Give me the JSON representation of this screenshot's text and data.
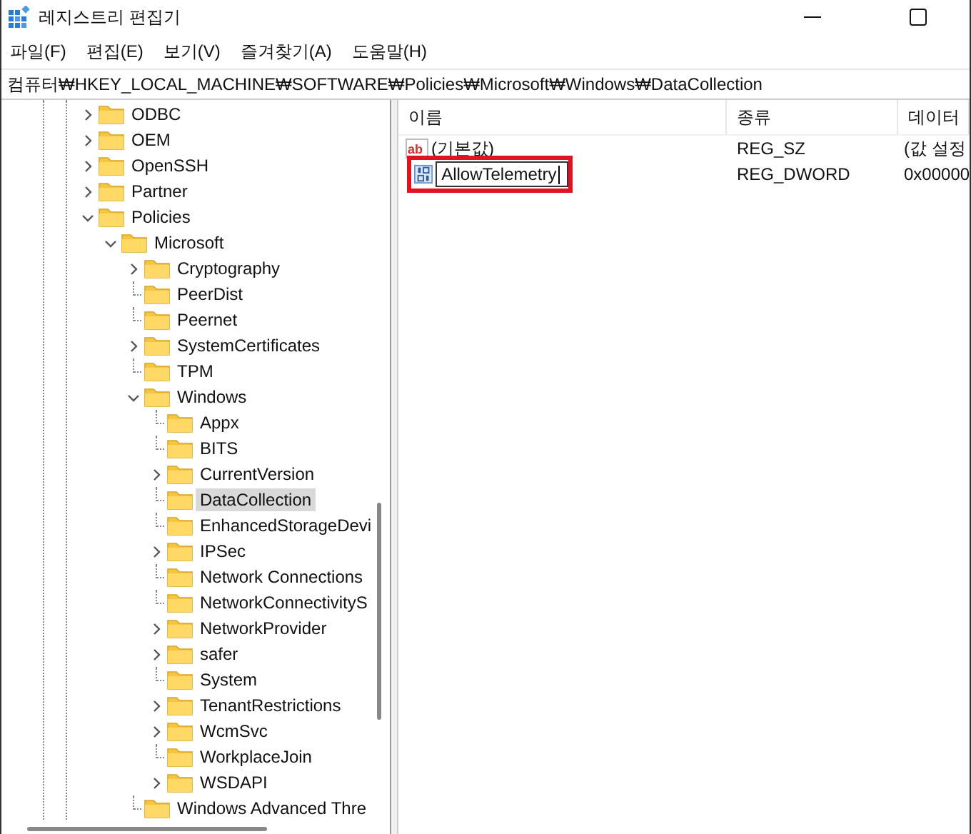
{
  "window": {
    "title": "레지스트리 편집기"
  },
  "menu": [
    "파일(F)",
    "편집(E)",
    "보기(V)",
    "즐겨찾기(A)",
    "도움말(H)"
  ],
  "address": "컴퓨터₩HKEY_LOCAL_MACHINE₩SOFTWARE₩Policies₩Microsoft₩Windows₩DataCollection",
  "tree": {
    "items": [
      {
        "label": "ODBC",
        "kind": "branch",
        "expanded": false,
        "selected": false
      },
      {
        "label": "OEM",
        "kind": "branch",
        "expanded": false,
        "selected": false
      },
      {
        "label": "OpenSSH",
        "kind": "branch",
        "expanded": false,
        "selected": false
      },
      {
        "label": "Partner",
        "kind": "branch",
        "expanded": false,
        "selected": false
      },
      {
        "label": "Policies",
        "kind": "branch",
        "expanded": true,
        "selected": false,
        "children": [
          {
            "label": "Microsoft",
            "kind": "branch",
            "expanded": true,
            "selected": false,
            "children": [
              {
                "label": "Cryptography",
                "kind": "branch",
                "expanded": false,
                "selected": false
              },
              {
                "label": "PeerDist",
                "kind": "leaf",
                "selected": false
              },
              {
                "label": "Peernet",
                "kind": "leaf",
                "selected": false
              },
              {
                "label": "SystemCertificates",
                "kind": "branch",
                "expanded": false,
                "selected": false
              },
              {
                "label": "TPM",
                "kind": "leaf",
                "selected": false
              },
              {
                "label": "Windows",
                "kind": "branch",
                "expanded": true,
                "selected": false,
                "children": [
                  {
                    "label": "Appx",
                    "kind": "leaf",
                    "selected": false
                  },
                  {
                    "label": "BITS",
                    "kind": "leaf",
                    "selected": false
                  },
                  {
                    "label": "CurrentVersion",
                    "kind": "branch",
                    "expanded": false,
                    "selected": false
                  },
                  {
                    "label": "DataCollection",
                    "kind": "leaf",
                    "selected": true
                  },
                  {
                    "label": "EnhancedStorageDevi",
                    "kind": "leaf",
                    "selected": false
                  },
                  {
                    "label": "IPSec",
                    "kind": "branch",
                    "expanded": false,
                    "selected": false
                  },
                  {
                    "label": "Network Connections",
                    "kind": "leaf",
                    "selected": false
                  },
                  {
                    "label": "NetworkConnectivityS",
                    "kind": "leaf",
                    "selected": false
                  },
                  {
                    "label": "NetworkProvider",
                    "kind": "branch",
                    "expanded": false,
                    "selected": false
                  },
                  {
                    "label": "safer",
                    "kind": "branch",
                    "expanded": false,
                    "selected": false
                  },
                  {
                    "label": "System",
                    "kind": "leaf",
                    "selected": false
                  },
                  {
                    "label": "TenantRestrictions",
                    "kind": "branch",
                    "expanded": false,
                    "selected": false
                  },
                  {
                    "label": "WcmSvc",
                    "kind": "branch",
                    "expanded": false,
                    "selected": false
                  },
                  {
                    "label": "WorkplaceJoin",
                    "kind": "leaf",
                    "selected": false
                  },
                  {
                    "label": "WSDAPI",
                    "kind": "branch",
                    "expanded": false,
                    "selected": false
                  }
                ]
              },
              {
                "label": "Windows Advanced Thre",
                "kind": "leaf",
                "selected": false
              }
            ]
          }
        ]
      }
    ]
  },
  "values": {
    "columns": [
      "이름",
      "종류",
      "데이터"
    ],
    "rows": [
      {
        "kind": "string",
        "icon_label": "ab",
        "name": "(기본값)",
        "type": "REG_SZ",
        "data": "(값 설정",
        "editing": false,
        "highlighted": false
      },
      {
        "kind": "binary",
        "name": "AllowTelemetry",
        "type": "REG_DWORD",
        "data": "0x00000",
        "editing": true,
        "highlighted": true
      }
    ]
  }
}
